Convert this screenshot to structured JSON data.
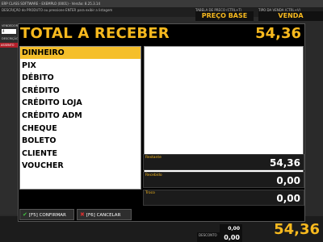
{
  "background": {
    "title_bar": "ERP CLASS SOFTWARE - EXEMPLO (0001) - Versão: 8.25.3.14",
    "sub_hint": "DESCRIÇÃO do PRODUTO ou pressione ENTER para exibir a listagem",
    "tabela_label": "TABELA DE PREÇO (CTRL+T)",
    "tipo_label": "TIPO DA VENDA (CTRL+V)",
    "preco_header": "PREÇO BASE",
    "venda_header": "VENDA",
    "vendedor_label": "VENDEDOR",
    "vendedor_value": "4",
    "descricao_label": "DESCRIÇÃO",
    "row_text": "ASSENTO",
    "bottom_total": "54,36",
    "bottom_value": "0,00",
    "desconto_label": "DESCONTO"
  },
  "modal": {
    "title": "TOTAL A RECEBER",
    "total": "54,36",
    "payment_methods": [
      "DINHEIRO",
      "PIX",
      "DÉBITO",
      "CRÉDITO",
      "CRÉDITO LOJA",
      "CRÉDITO ADM",
      "CHEQUE",
      "BOLETO",
      "CLIENTE",
      "VOUCHER"
    ],
    "selected_index": 0,
    "restante_label": "Restante",
    "restante_value": "54,36",
    "recebido_label": "Recebido",
    "recebido_value": "0,00",
    "troco_label": "Troco",
    "troco_value": "0,00",
    "confirm_label": "[F5] CONFIRMAR",
    "cancel_label": "[F6] CANCELAR",
    "colors": {
      "accent": "#f5bf2a",
      "background": "#000000"
    }
  }
}
